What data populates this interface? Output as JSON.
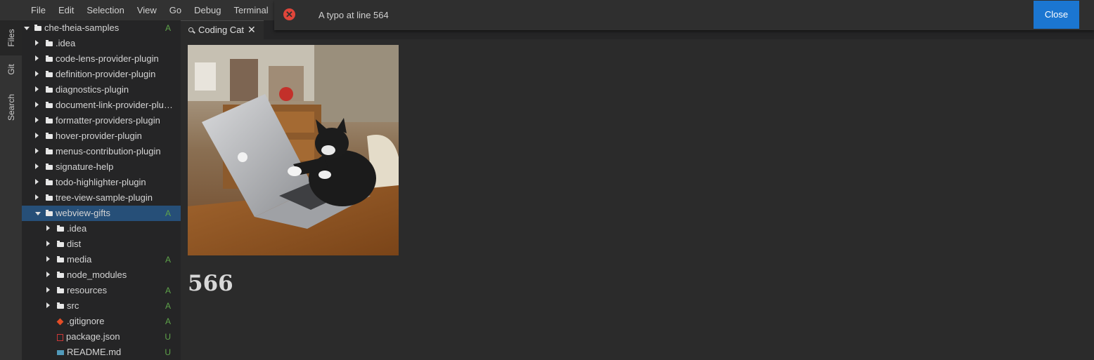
{
  "menubar": {
    "items": [
      "File",
      "Edit",
      "Selection",
      "View",
      "Go",
      "Debug",
      "Terminal"
    ]
  },
  "notification": {
    "message": "A typo at line 564",
    "close_label": "Close",
    "severity_icon": "error-icon"
  },
  "activity_bar": {
    "tabs": [
      "Files",
      "Git",
      "Search"
    ]
  },
  "explorer": {
    "items": [
      {
        "label": "che-theia-samples",
        "status": "A"
      },
      {
        "label": ".idea",
        "status": ""
      },
      {
        "label": "code-lens-provider-plugin",
        "status": ""
      },
      {
        "label": "definition-provider-plugin",
        "status": ""
      },
      {
        "label": "diagnostics-plugin",
        "status": ""
      },
      {
        "label": "document-link-provider-plugin",
        "status": ""
      },
      {
        "label": "formatter-providers-plugin",
        "status": ""
      },
      {
        "label": "hover-provider-plugin",
        "status": ""
      },
      {
        "label": "menus-contribution-plugin",
        "status": ""
      },
      {
        "label": "signature-help",
        "status": ""
      },
      {
        "label": "todo-highlighter-plugin",
        "status": ""
      },
      {
        "label": "tree-view-sample-plugin",
        "status": ""
      },
      {
        "label": "webview-gifts",
        "status": "A"
      },
      {
        "label": ".idea",
        "status": ""
      },
      {
        "label": "dist",
        "status": ""
      },
      {
        "label": "media",
        "status": "A"
      },
      {
        "label": "node_modules",
        "status": ""
      },
      {
        "label": "resources",
        "status": "A"
      },
      {
        "label": "src",
        "status": "A"
      },
      {
        "label": ".gitignore",
        "status": "A"
      },
      {
        "label": "package.json",
        "status": "U"
      },
      {
        "label": "README.md",
        "status": "U"
      }
    ]
  },
  "editor_tab": {
    "label": "Coding Cat",
    "close_glyph": "✕"
  },
  "webview": {
    "image_alt": "coding cat",
    "counter": "566"
  }
}
